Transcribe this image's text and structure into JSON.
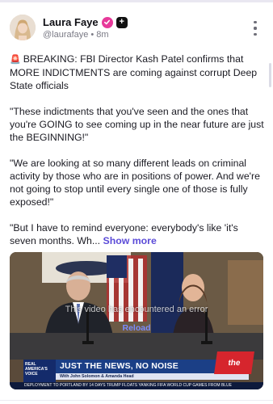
{
  "post": {
    "author_name": "Laura Faye",
    "handle": "@laurafaye",
    "separator": "•",
    "timestamp": "8m",
    "paragraph1": "BREAKING: FBI Director Kash Patel confirms that MORE INDICTMENTS are coming against corrupt Deep State officials",
    "siren_icon": "🚨",
    "paragraph2": "\"These indictments that you've seen and the ones that you're GOING to see coming up in the near future are just the BEGINNING!\"",
    "paragraph3": "\"We are looking at so many different leads on criminal activity by those who are in positions of power. And we're not going to stop until every single one of those is fully exposed!\"",
    "paragraph4": "\"But I have to remind everyone: everybody's like 'it's seven months. Wh...",
    "show_more_label": "Show more",
    "badge_plus_label": "+"
  },
  "media": {
    "overlay_message": "This video has encountered an error",
    "overlay_link": "Reload",
    "lower_third": {
      "logo_text": "REAL AMERICA'S VOICE",
      "headline": "JUST THE NEWS, NO NOISE",
      "subline": "With John Solomon & Amanda Head",
      "brand": "the"
    },
    "ticker": "DEPLOYMENT TO PORTLAND BY 14 DAYS     TRUMP FLOATS YANKING FIFA WORLD CUP GAMES FROM BLUE"
  },
  "colors": {
    "accent": "#5b4bd8",
    "verified_badge": "#e7399a",
    "text": "#1a1a22",
    "muted": "#7a7a85"
  }
}
